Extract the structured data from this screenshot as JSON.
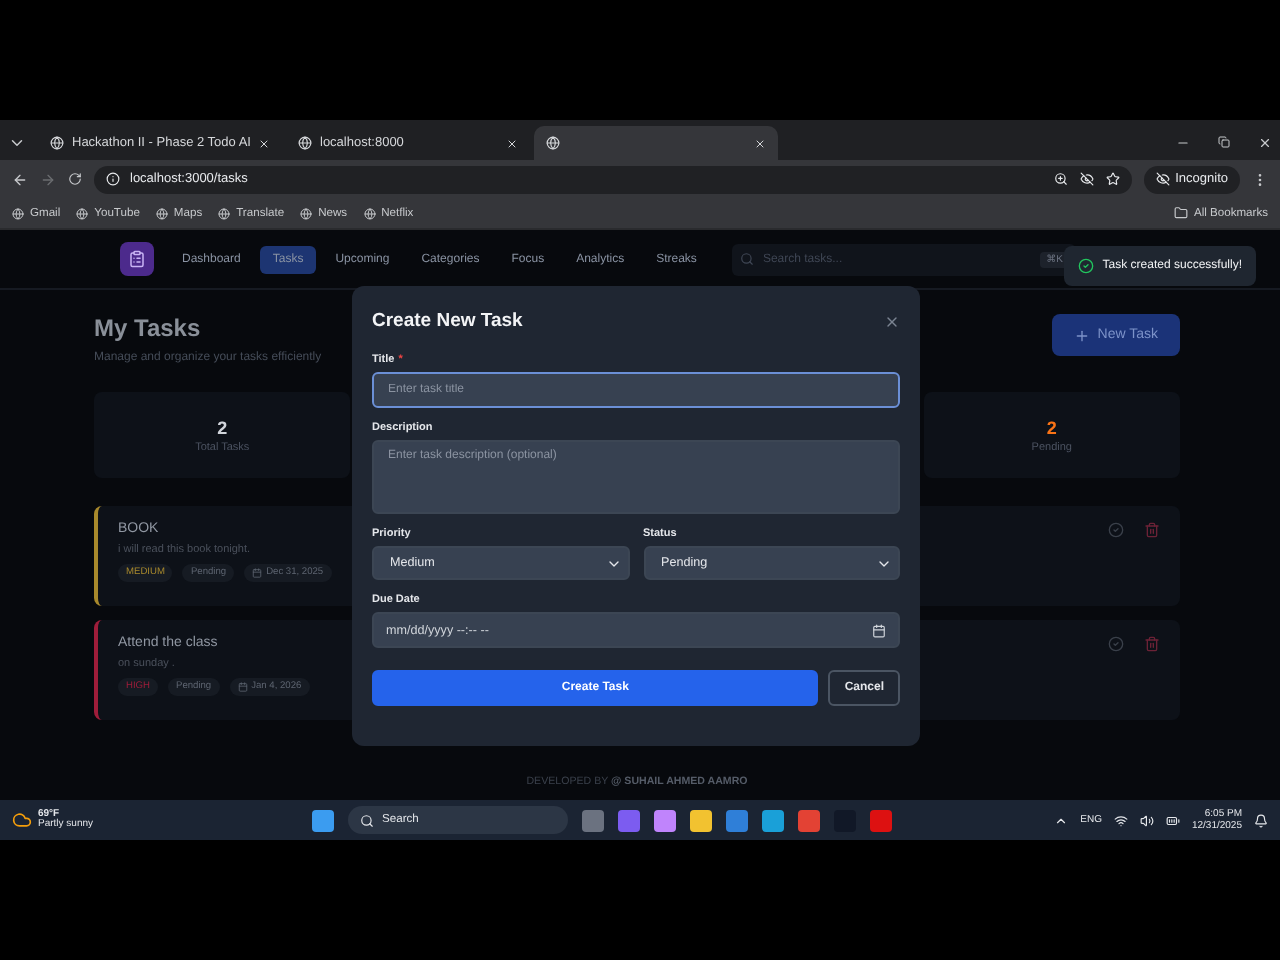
{
  "browser": {
    "tabs": [
      {
        "title": "Hackathon II - Phase 2 Todo AI",
        "selected": false
      },
      {
        "title": "localhost:8000",
        "selected": false
      },
      {
        "selected": true
      }
    ],
    "url": "localhost:3000/tasks",
    "profile": "Incognito",
    "bookmarks": [
      "Gmail",
      "YouTube",
      "Maps",
      "Translate",
      "News",
      "Netflix"
    ],
    "all_bookmarks": "All Bookmarks"
  },
  "nav": {
    "items": [
      {
        "label": "Dashboard",
        "selected": false
      },
      {
        "label": "Tasks",
        "selected": true
      },
      {
        "label": "Upcoming",
        "selected": false
      },
      {
        "label": "Categories",
        "selected": false
      },
      {
        "label": "Focus",
        "selected": false
      },
      {
        "label": "Analytics",
        "selected": false
      },
      {
        "label": "Streaks",
        "selected": false
      }
    ],
    "search": {
      "placeholder": "Search tasks...",
      "shortcut": "⌘K"
    }
  },
  "toast": {
    "message": "Task created successfully!"
  },
  "page": {
    "title": "My Tasks",
    "subtitle": "Manage and organize your tasks efficiently",
    "new_button": "New Task",
    "stats": [
      {
        "value": "2",
        "label": "Total Tasks",
        "color": "#d1d5db"
      },
      {
        "value": "2",
        "label": "Pending",
        "color": "#f97316"
      }
    ],
    "tasks": [
      {
        "title": "BOOK",
        "description": "i will read this book tonight.",
        "priority": "MEDIUM",
        "color": "#a8892c",
        "status": "Pending",
        "due": "Dec 31, 2025"
      },
      {
        "title": "Attend the class",
        "description": "on sunday .",
        "priority": "HIGH",
        "color": "#9f1d3a",
        "status": "Pending",
        "due": "Jan 4, 2026"
      }
    ]
  },
  "modal": {
    "title": "Create New Task",
    "fields": [
      {
        "kind": "text",
        "label": "Title",
        "required_mark": "*",
        "placeholder": "Enter task title",
        "focused": true
      },
      {
        "kind": "textarea",
        "label": "Description",
        "placeholder": "Enter task description (optional)",
        "focused": false
      },
      {
        "kind": "select",
        "label": "Priority",
        "value": "Medium",
        "focused": false
      },
      {
        "kind": "select",
        "label": "Status",
        "value": "Pending",
        "focused": false
      },
      {
        "kind": "datetime",
        "label": "Due Date",
        "value": "mm/dd/yyyy --:-- --",
        "focused": false
      }
    ],
    "buttons": [
      {
        "label": "Create Task",
        "kind": "primary"
      },
      {
        "label": "Cancel",
        "kind": "secondary"
      }
    ]
  },
  "footer": {
    "prefix": "DEVELOPED BY",
    "author": "@ SUHAIL AHMED AAMRO"
  },
  "taskbar": {
    "temperature": "69°F",
    "condition": "Partly sunny",
    "search": "Search",
    "language": "ENG",
    "time": "6:05 PM",
    "date": "12/31/2025"
  }
}
